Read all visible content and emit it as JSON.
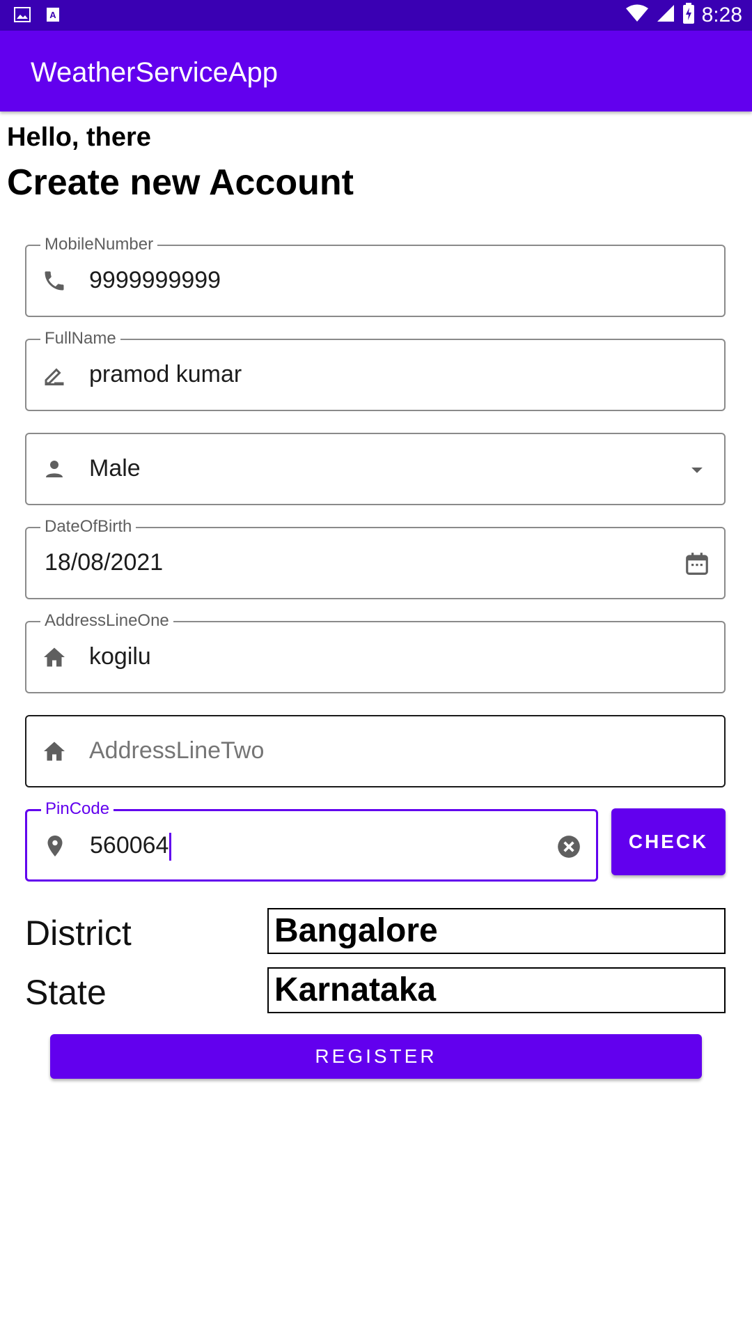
{
  "status_bar": {
    "time": "8:28",
    "left_icons": [
      "image-icon",
      "text-a-icon"
    ],
    "right_icons": [
      "wifi-icon",
      "signal-icon",
      "battery-charging-icon"
    ]
  },
  "app_bar": {
    "title": "WeatherServiceApp"
  },
  "header": {
    "greeting": "Hello, there",
    "title": "Create new Account"
  },
  "form": {
    "mobile": {
      "label": "MobileNumber",
      "value": "9999999999",
      "icon": "phone-icon"
    },
    "fullname": {
      "label": "FullName",
      "value": "pramod kumar",
      "icon": "edit-icon"
    },
    "gender": {
      "value": "Male",
      "icon": "person-icon",
      "trailing": "dropdown-arrow-icon"
    },
    "dob": {
      "label": "DateOfBirth",
      "value": "18/08/2021",
      "trailing": "calendar-icon"
    },
    "address1": {
      "label": "AddressLineOne",
      "value": "kogilu",
      "icon": "home-icon"
    },
    "address2": {
      "placeholder": "AddressLineTwo",
      "icon": "home-icon"
    },
    "pincode": {
      "label": "PinCode",
      "value": "560064",
      "icon": "location-pin-icon",
      "trailing": "clear-icon"
    },
    "check_button": "CHECK"
  },
  "result": {
    "district_label": "District",
    "district_value": "Bangalore",
    "state_label": "State",
    "state_value": "Karnataka"
  },
  "register_button": "REGISTER",
  "colors": {
    "primary": "#6200ee",
    "status_bar": "#3a00b3"
  }
}
